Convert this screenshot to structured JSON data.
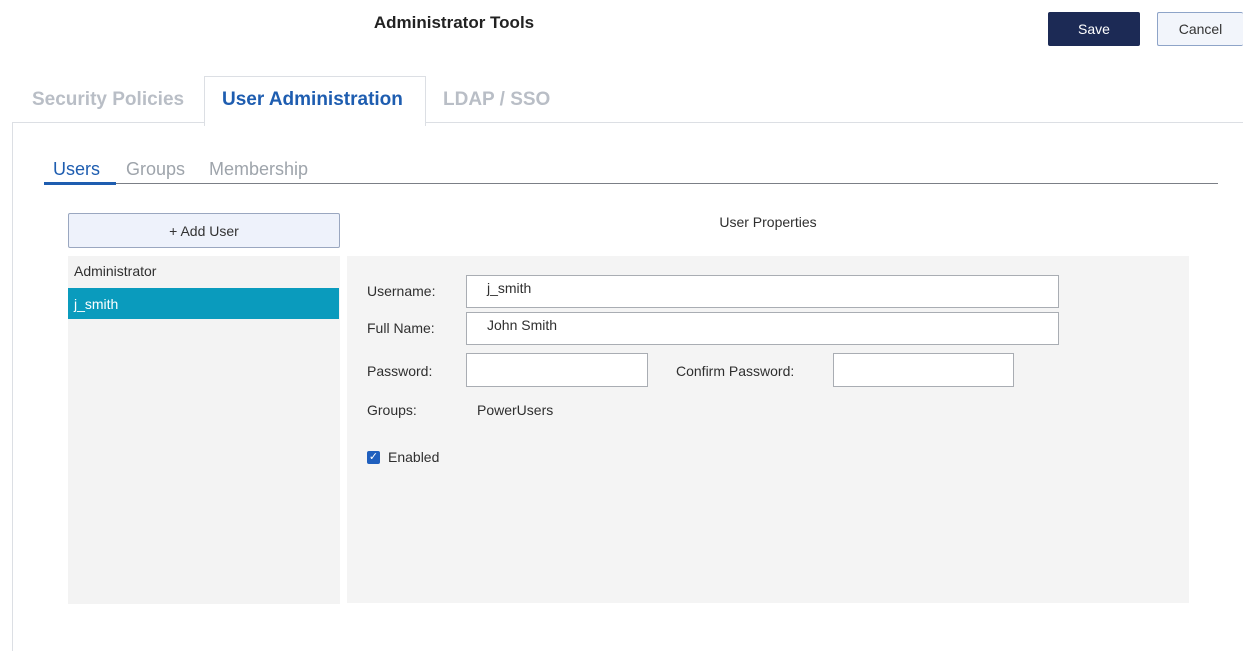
{
  "header": {
    "title": "Administrator Tools",
    "save_label": "Save",
    "cancel_label": "Cancel"
  },
  "tabs": [
    {
      "label": "Security Policies",
      "active": false
    },
    {
      "label": "User Administration",
      "active": true
    },
    {
      "label": "LDAP / SSO",
      "active": false
    }
  ],
  "subtabs": [
    {
      "label": "Users",
      "active": true
    },
    {
      "label": "Groups",
      "active": false
    },
    {
      "label": "Membership",
      "active": false
    }
  ],
  "users": {
    "add_label": "+ Add User",
    "items": [
      {
        "name": "Administrator",
        "selected": false
      },
      {
        "name": "j_smith",
        "selected": true
      }
    ]
  },
  "properties": {
    "title": "User Properties",
    "username_label": "Username:",
    "username_value": "j_smith",
    "fullname_label": "Full Name:",
    "fullname_value": "John Smith",
    "password_label": "Password:",
    "password_value": "",
    "confirm_label": "Confirm Password:",
    "confirm_value": "",
    "groups_label": "Groups:",
    "groups_value": "PowerUsers",
    "enabled_label": "Enabled",
    "enabled_checked": true
  },
  "colors": {
    "accent": "#1e5db0",
    "primary_button": "#1c2a55",
    "selection": "#0a9bbd"
  }
}
